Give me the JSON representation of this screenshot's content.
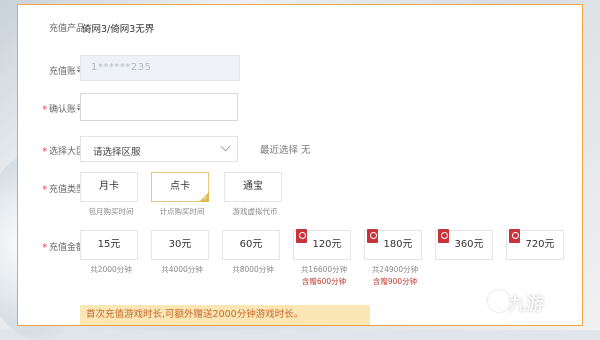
{
  "form": {
    "product_label": "充值产品:",
    "product_value": "倚网3/倚网3无界",
    "account_label": "充值账号:",
    "account_value": "1******235",
    "confirm_label": "确认账号:",
    "confirm_value": "",
    "region_label": "选择大区:",
    "region_placeholder": "请选择区服",
    "recent_text": "最近选择  无",
    "type_label": "充值类型:",
    "types": [
      {
        "name": "月卡",
        "desc": "包月购买时间"
      },
      {
        "name": "点卡",
        "desc": "计点购买时间",
        "selected": true
      },
      {
        "name": "通宝",
        "desc": "游戏虚拟代币"
      }
    ],
    "amount_label": "充值金额:",
    "amounts": [
      {
        "price": "15元",
        "minutes": "共2000分钟",
        "gift": ""
      },
      {
        "price": "30元",
        "minutes": "共4000分钟",
        "gift": ""
      },
      {
        "price": "60元",
        "minutes": "共8000分钟",
        "gift": ""
      },
      {
        "price": "120元",
        "minutes": "共16600分钟",
        "gift": "含赠600分钟"
      },
      {
        "price": "180元",
        "minutes": "共24900分钟",
        "gift": "含赠900分钟"
      },
      {
        "price": "360元",
        "minutes": "",
        "gift": ""
      },
      {
        "price": "720元",
        "minutes": "",
        "gift": ""
      }
    ],
    "notice": "首次充值游戏时长,可额外赠送2000分钟游戏时长。"
  },
  "watermark": "九游",
  "colors": {
    "accent": "#f0a246",
    "gift": "#c8343b",
    "notice_bg": "#fbe6b6",
    "notice_text": "#c4682a"
  }
}
